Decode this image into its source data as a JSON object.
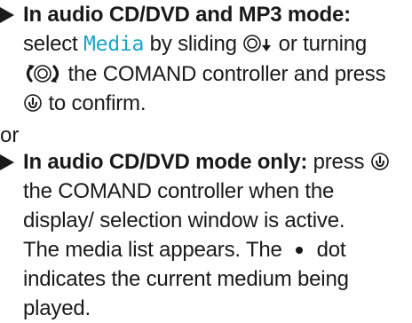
{
  "step1": {
    "lead": "In audio CD/DVD and MP3 mode:",
    "t1": " select ",
    "keyword": "Media",
    "t2": " by sliding ",
    "t3": " or turning ",
    "t4": " the COMAND controller and press ",
    "t5": " to confirm."
  },
  "separator": "or",
  "step2": {
    "lead": "In audio CD/DVD mode only:",
    "t1": " press ",
    "t2": " the COMAND controller when the display/ selection window is active.",
    "result_before": "The media list appears. The ",
    "result_after": " dot indicates the current medium being played."
  },
  "icons": {
    "slide": "slide-down-controller-icon",
    "turn": "turn-controller-icon",
    "press": "press-controller-icon",
    "dot": "current-medium-dot-icon"
  },
  "colors": {
    "keyword": "#1aa6c5",
    "text": "#1a1a1a"
  }
}
